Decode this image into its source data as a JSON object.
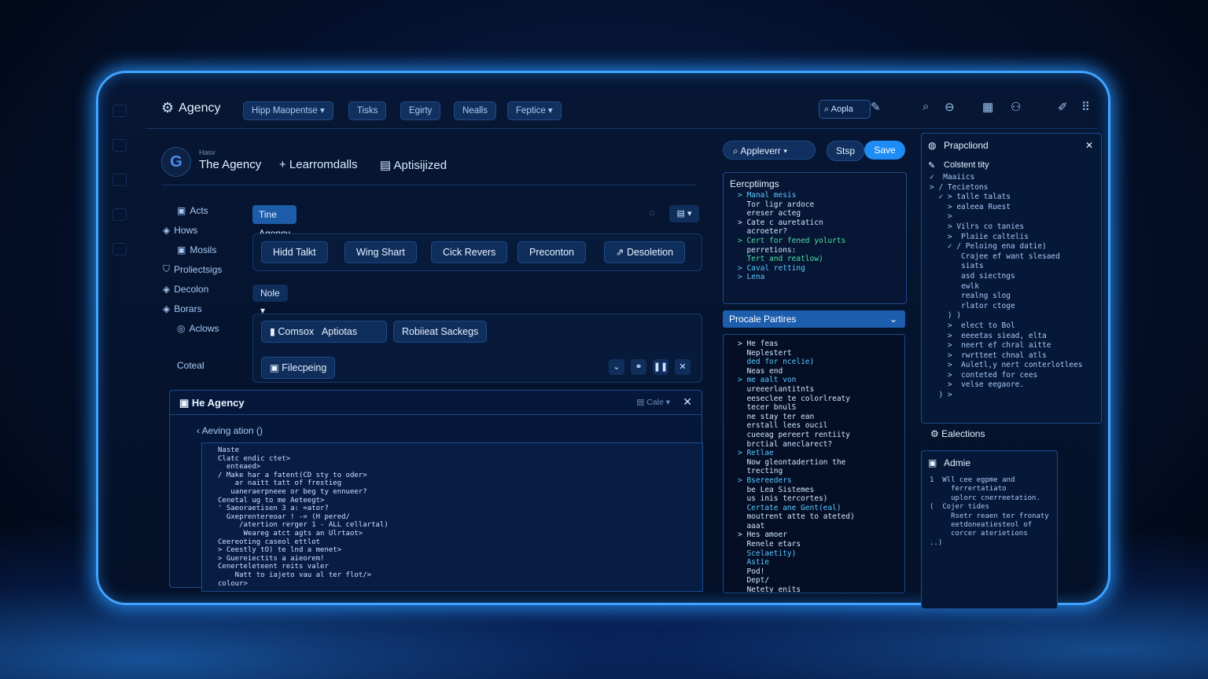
{
  "topbar": {
    "brand": "Agency",
    "menus": [
      "Hipp Maopentse",
      "Tisks",
      "Egirty",
      "Nealls",
      "Feptice"
    ],
    "search_text": "Aopla"
  },
  "header": {
    "kicker": "Hasv",
    "title": "The Agency",
    "link1": "+ Learromdalls",
    "link2": "Aptisijized"
  },
  "sidebar": {
    "items": [
      "Acts",
      "Hows",
      "Mosils",
      "Proliectsigs",
      "Decolon",
      "Borars",
      "Aclows"
    ],
    "footer": "Coteal"
  },
  "workspace": {
    "active_chip": "Tine Agency",
    "actions": [
      "Hidd Talkt",
      "Wing Shart",
      "Cick Revers",
      "Preconton",
      "Desoletion"
    ],
    "node_select": "Nole",
    "tools_row1": [
      "Comsox",
      "Aptiotas",
      "Robiieat Sackegs"
    ],
    "tools_row2": "Filecpeing"
  },
  "bottom_panel": {
    "title": "He Agency",
    "right_label": "Cale",
    "subtitle": "Aeving ation",
    "code": [
      "Naste",
      "Clatc endic ctet>",
      "  enteaed>",
      "/ Make har a fatent(CD sty to oder>",
      "    ar naitt tatt of frestieg",
      "   uaneraerpneee or beg ty ennueer?",
      "Cenetal ug to me Aeteegt>",
      "' Saeoraetisen 3 a: =ator?",
      "  Gxeprentereoar ! -= (H pered/",
      "     /atertion rerger 1 - ALL cellartal)",
      "      Weareg atct agts an Ulrtaot>",
      "Ceereoting caseol ettlot",
      "> Ceestly tO) te lnd a menet>",
      "> Guereiectits a aieorem!",
      "Cenerteleteent reits valer",
      "    Natt to iajeto vau al ter flot/>",
      "colour>"
    ]
  },
  "mid_column": {
    "search_label": "Appleverr",
    "stop_label": "Stsp",
    "save_label": "Save",
    "desc_title": "Eercptiimgs",
    "desc_lines": [
      "> Manal mesis",
      "  Tor ligr ardoce",
      "  ereser acteg",
      "> Cate c auretaticn",
      "  acroeter?",
      "> Cert for fened yolurts",
      "  perretions:",
      "  Tert and reatlow)",
      "> Caval retting",
      "> Lena"
    ],
    "blue_bar": "Procale Partires",
    "list_lines": [
      "> He feas",
      "  Neplestert",
      "  ded for ncelie)",
      "  Neas end",
      "> me aalt von",
      "  ureeerlantitnts",
      "  eeseclee te colorlreaty",
      "  tecer bnulS",
      "  ne stay ter ean",
      "  erstall lees oucil",
      "  cueeag pereert rentiity",
      "  brctial aneclarect?",
      "",
      "> Retlae",
      "  Now gleontadertion the",
      "  trecting",
      "",
      "> Bsereeders",
      "  be Lea Sistemes",
      "  us inis tercortes)",
      "  Certate ane Gent(eal)",
      "  moutrent atte to ateted)",
      "  aaat",
      "> Hes amoer",
      "  Renele etars",
      "  Scelaetity)",
      "  Astie",
      "  Pod!",
      "  Dept/",
      "  Netety enits"
    ]
  },
  "right_panel": {
    "title": "Prapcliond",
    "item1": "Colstent tity",
    "lines": [
      "✓  Maaiics",
      "> / Tecietons",
      "  ✓ > talle talats",
      "    > ealeea Ruest",
      "    >",
      "    > Vilrs co tanies",
      "    >  Plaiie caltelis",
      "    ✓ / Peloing ena datie)",
      "",
      "       Crajee ef want slesaed",
      "       siats",
      "       asd siectngs",
      "       ewlk",
      "       realng slog",
      "       rlator ctoge",
      "    ) )",
      "    >  elect to Bol",
      "    >  eeeetas siead, elta",
      "    >  neert ef chral aitte",
      "    >  rwrtteet chnal atls",
      "    >  Auletl,y nert conterlotlees",
      "    >  conteted for cees",
      "    >  velse eegaore.",
      "  ) >"
    ],
    "selections_label": "Ealections",
    "admin_title": "Admie",
    "admin_lines": [
      "1  Wll cee egpme and",
      "     ferrertatiato",
      "     uplorc cnerreetation.",
      "(  Cojer tides",
      "     Rsetr reaen ter fronaty",
      "     eetdoneatiesteol of",
      "     corcer aterietions",
      "..)"
    ]
  },
  "colors": {
    "accent": "#1e8cf5",
    "frame_glow": "#3fa3ff",
    "panel_bg": "#061634",
    "code_green": "#4fe0a0",
    "code_yellow": "#dfe86a"
  }
}
